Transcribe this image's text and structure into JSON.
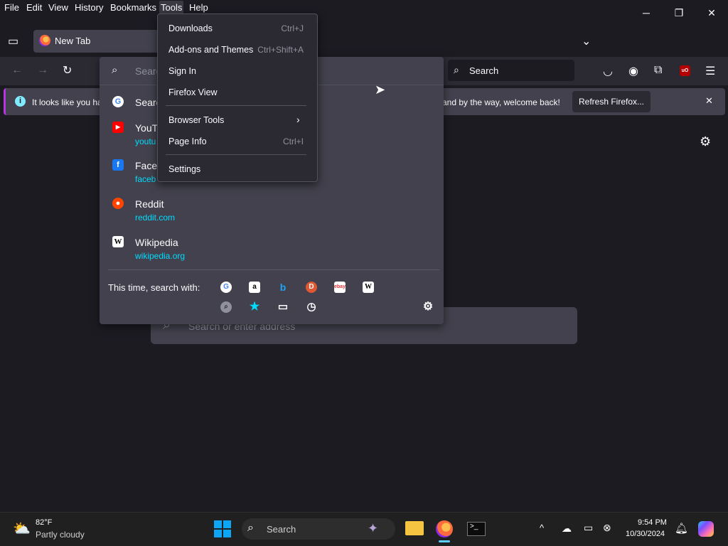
{
  "menubar": {
    "items": [
      "File",
      "Edit",
      "View",
      "History",
      "Bookmarks",
      "Tools",
      "Help"
    ]
  },
  "tab": {
    "title": "New Tab"
  },
  "navbar": {
    "search_placeholder": "Search"
  },
  "urlbar": {
    "placeholder": "Search",
    "suggestions": [
      {
        "title": "Search",
        "url": ""
      },
      {
        "title": "YouT",
        "url": "youtu"
      },
      {
        "title": "Faceb",
        "url": "faceb"
      },
      {
        "title": "Reddit",
        "url": "reddit.com"
      },
      {
        "title": "Wikipedia",
        "url": "wikipedia.org"
      }
    ],
    "oneoff_label": "This time, search with:"
  },
  "notification": {
    "text_left": "It looks like you ha",
    "text_right": "and by the way, welcome back!",
    "button": "Refresh Firefox..."
  },
  "tools_menu": {
    "items": [
      {
        "label": "Downloads",
        "shortcut": "Ctrl+J"
      },
      {
        "label": "Add-ons and Themes",
        "shortcut": "Ctrl+Shift+A"
      },
      {
        "label": "Sign In",
        "shortcut": ""
      },
      {
        "label": "Firefox View",
        "shortcut": ""
      },
      {
        "label": "Browser Tools",
        "shortcut": ""
      },
      {
        "label": "Page Info",
        "shortcut": "Ctrl+I"
      },
      {
        "label": "Settings",
        "shortcut": ""
      }
    ]
  },
  "content": {
    "search_placeholder": "Search or enter address"
  },
  "taskbar": {
    "weather_temp": "82°F",
    "weather_desc": "Partly cloudy",
    "search_label": "Search",
    "time": "9:54 PM",
    "date": "10/30/2024"
  },
  "colors": {
    "accent": "#00ddff",
    "background": "#1c1b22",
    "panel": "#42414d"
  }
}
